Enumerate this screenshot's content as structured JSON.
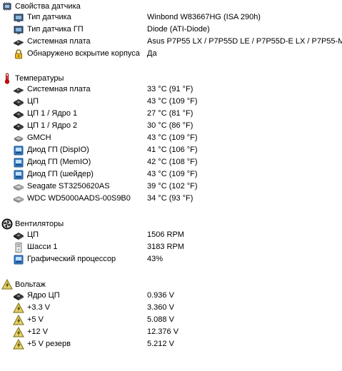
{
  "sections": [
    {
      "title": "Свойства датчика",
      "icon": "sensor-chip-icon",
      "rows": [
        {
          "label": "Тип датчика",
          "value": "Winbond W83667HG  (ISA 290h)",
          "icon": "sensor-chip-icon"
        },
        {
          "label": "Тип датчика ГП",
          "value": "Diode  (ATI-Diode)",
          "icon": "sensor-chip-icon"
        },
        {
          "label": "Системная плата",
          "value": "Asus P7P55 LX / P7P55D LE / P7P55D-E LX / P7P55-M",
          "icon": "motherboard-icon"
        },
        {
          "label": "Обнаружено вскрытие корпуса",
          "value": "Да",
          "icon": "lock-icon"
        }
      ]
    },
    {
      "title": "Температуры",
      "icon": "thermometer-icon",
      "rows": [
        {
          "label": "Системная плата",
          "value": "33 °C  (91 °F)",
          "icon": "motherboard-icon"
        },
        {
          "label": "ЦП",
          "value": "43 °C  (109 °F)",
          "icon": "cpu-icon"
        },
        {
          "label": "ЦП 1 / Ядро 1",
          "value": "27 °C  (81 °F)",
          "icon": "cpu-icon"
        },
        {
          "label": "ЦП 1 / Ядро 2",
          "value": "30 °C  (86 °F)",
          "icon": "cpu-icon"
        },
        {
          "label": "GMCH",
          "value": "43 °C  (109 °F)",
          "icon": "chipset-icon"
        },
        {
          "label": "Диод ГП (DispIO)",
          "value": "41 °C  (106 °F)",
          "icon": "gpu-diode-icon"
        },
        {
          "label": "Диод ГП (MemIO)",
          "value": "42 °C  (108 °F)",
          "icon": "gpu-diode-icon"
        },
        {
          "label": "Диод ГП (шейдер)",
          "value": "43 °C  (109 °F)",
          "icon": "gpu-diode-icon"
        },
        {
          "label": "Seagate ST3250620AS",
          "value": "39 °C  (102 °F)",
          "icon": "hard-drive-icon"
        },
        {
          "label": "WDC WD5000AADS-00S9B0",
          "value": "34 °C  (93 °F)",
          "icon": "hard-drive-icon"
        }
      ]
    },
    {
      "title": "Вентиляторы",
      "icon": "fan-icon",
      "rows": [
        {
          "label": "ЦП",
          "value": "1506 RPM",
          "icon": "cpu-icon"
        },
        {
          "label": "Шасси 1",
          "value": "3183 RPM",
          "icon": "chassis-icon"
        },
        {
          "label": "Графический процессор",
          "value": "43%",
          "icon": "gpu-diode-icon"
        }
      ]
    },
    {
      "title": "Вольтаж",
      "icon": "voltage-icon",
      "rows": [
        {
          "label": "Ядро ЦП",
          "value": "0.936 V",
          "icon": "cpu-icon"
        },
        {
          "label": "+3.3 V",
          "value": "3.360 V",
          "icon": "voltage-icon"
        },
        {
          "label": "+5 V",
          "value": "5.088 V",
          "icon": "voltage-icon"
        },
        {
          "label": "+12 V",
          "value": "12.376 V",
          "icon": "voltage-icon"
        },
        {
          "label": "+5 V резерв",
          "value": "5.212 V",
          "icon": "voltage-icon"
        }
      ]
    }
  ]
}
